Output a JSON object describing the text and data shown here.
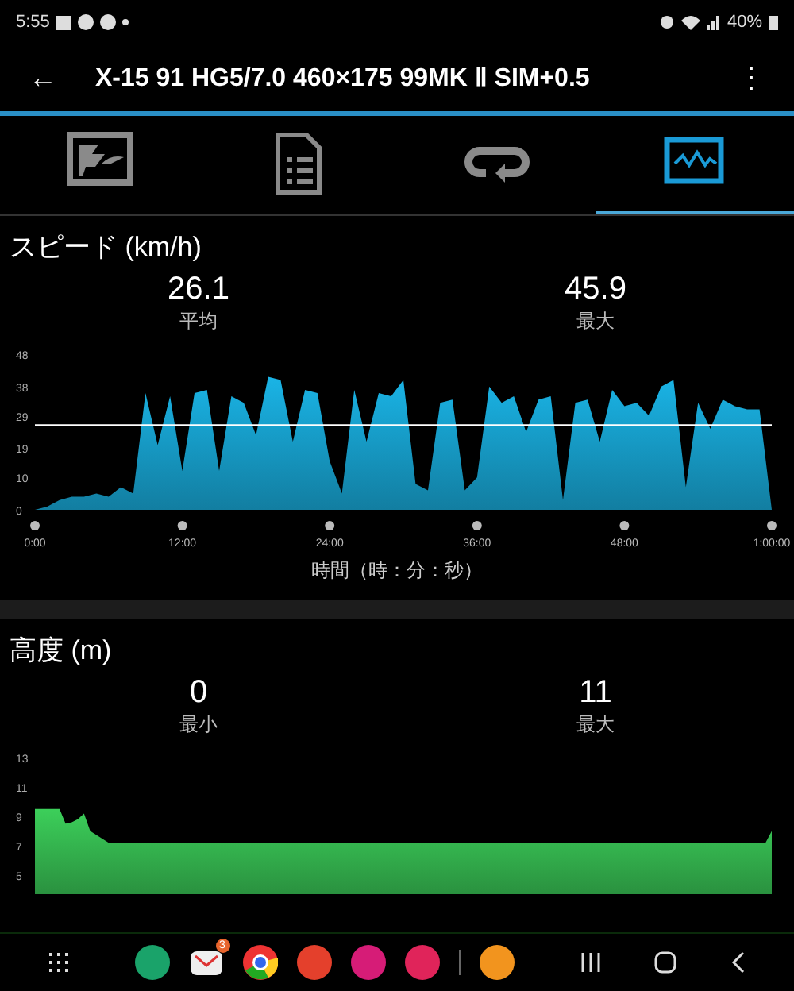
{
  "status_bar": {
    "time": "5:55",
    "battery": "40%"
  },
  "app_bar": {
    "back": "←",
    "title": "X-15 91 HG5/7.0 460×175 99MK Ⅱ SIM+0.5",
    "menu": "⋮"
  },
  "tabs": [
    {
      "kind": "map",
      "selected": false
    },
    {
      "kind": "document",
      "selected": false
    },
    {
      "kind": "loop",
      "selected": false
    },
    {
      "kind": "chart",
      "selected": true
    }
  ],
  "sections": [
    {
      "title": "スピード (km/h)",
      "stats": [
        {
          "value": "26.1",
          "label": "平均"
        },
        {
          "value": "45.9",
          "label": "最大"
        }
      ],
      "chart_data": {
        "type": "area",
        "xlabel": "時間（時：分：秒）",
        "xlim": [
          0,
          60
        ],
        "ylim": [
          0,
          48
        ],
        "x": [
          0,
          1,
          2,
          3,
          4,
          5,
          6,
          7,
          8,
          9,
          10,
          11,
          12,
          13,
          14,
          15,
          16,
          17,
          18,
          19,
          20,
          21,
          22,
          23,
          24,
          25,
          26,
          27,
          28,
          29,
          30,
          31,
          32,
          33,
          34,
          35,
          36,
          37,
          38,
          39,
          40,
          41,
          42,
          43,
          44,
          45,
          46,
          47,
          48,
          49,
          50,
          51,
          52,
          53,
          54,
          55,
          56,
          57,
          58,
          59,
          60
        ],
        "series": [
          {
            "color": "#1ab4e6",
            "values": [
              0,
              1,
              3,
              4,
              4,
              5,
              4,
              7,
              5,
              36,
              20,
              35,
              12,
              36,
              37,
              12,
              35,
              33,
              23,
              41,
              40,
              21,
              37,
              36,
              15,
              5,
              37,
              21,
              36,
              35,
              40,
              8,
              6,
              33,
              34,
              6,
              10,
              38,
              33,
              35,
              24,
              34,
              35,
              3,
              33,
              34,
              21,
              37,
              32,
              33,
              29,
              38,
              40,
              7,
              33,
              25,
              34,
              32,
              31,
              31,
              0
            ]
          }
        ],
        "xticks": [
          {
            "value": 0,
            "label": "0:00"
          },
          {
            "value": 12,
            "label": "12:00"
          },
          {
            "value": 24,
            "label": "24:00"
          },
          {
            "value": 36,
            "label": "36:00"
          },
          {
            "value": 48,
            "label": "48:00"
          },
          {
            "value": 60,
            "label": "1:00:00"
          }
        ],
        "yticks": [
          0,
          10,
          19,
          29,
          38,
          48
        ],
        "ref_lines": [
          {
            "axis": "y",
            "value": 26.1
          }
        ]
      }
    },
    {
      "title": "高度 (m)",
      "stats": [
        {
          "value": "0",
          "label": "最小"
        },
        {
          "value": "11",
          "label": "最大"
        }
      ],
      "chart_data": {
        "type": "area",
        "xlim": [
          0,
          60
        ],
        "ylim": [
          5,
          13
        ],
        "x": [
          0,
          1,
          2,
          2.5,
          3,
          3.5,
          4,
          4.5,
          6,
          10,
          20,
          30,
          40,
          50,
          59.5,
          60
        ],
        "series": [
          {
            "color": "#3ccf5a",
            "values": [
              9.5,
              9.5,
              9.5,
              8.5,
              8.6,
              8.8,
              9.2,
              8,
              7.2,
              7.2,
              7.2,
              7.2,
              7.2,
              7.2,
              7.2,
              8
            ]
          }
        ],
        "yticks": [
          5,
          7,
          9,
          11,
          13
        ]
      }
    }
  ],
  "nav_bar": {
    "mail_badge": "3"
  }
}
